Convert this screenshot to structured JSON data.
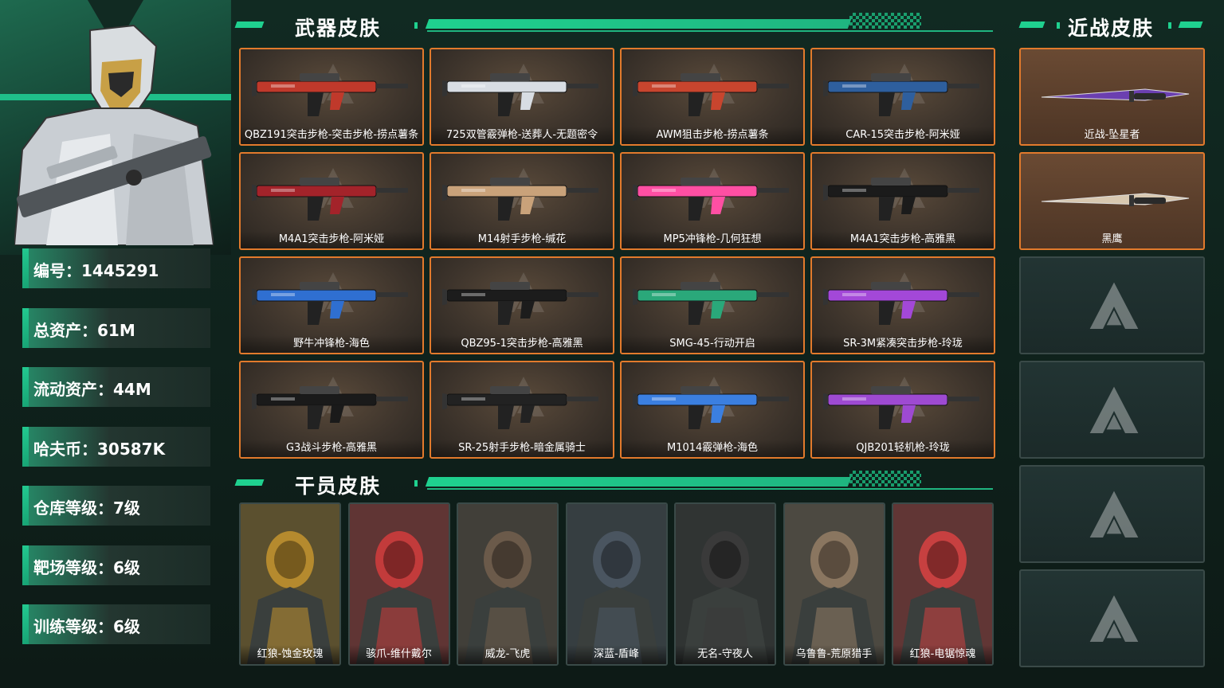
{
  "player": {
    "stats": [
      {
        "label": "编号：1445291"
      },
      {
        "label": "总资产：61M"
      },
      {
        "label": "流动资产：44M"
      },
      {
        "label": "哈夫币：30587K"
      },
      {
        "label": "仓库等级：7级"
      },
      {
        "label": "靶场等级：6级"
      },
      {
        "label": "训练等级：6级"
      }
    ]
  },
  "sections": {
    "weapon_title": "武器皮肤",
    "melee_title": "近战皮肤",
    "operator_title": "干员皮肤"
  },
  "weapons": [
    {
      "name": "QBZ191突击步枪-突击步枪-捞点薯条",
      "color": "#c0392b"
    },
    {
      "name": "725双管霰弹枪-送葬人-无题密令",
      "color": "#d8dde3"
    },
    {
      "name": "AWM狙击步枪-捞点薯条",
      "color": "#c8452e"
    },
    {
      "name": "CAR-15突击步枪-阿米娅",
      "color": "#2e5f9e"
    },
    {
      "name": "M4A1突击步枪-阿米娅",
      "color": "#a3232a"
    },
    {
      "name": "M14射手步枪-缄花",
      "color": "#c9a27a"
    },
    {
      "name": "MP5冲锋枪-几何狂想",
      "color": "#ff4fa3"
    },
    {
      "name": "M4A1突击步枪-高雅黑",
      "color": "#1b1b1b"
    },
    {
      "name": "野牛冲锋枪-海色",
      "color": "#2f6fd1"
    },
    {
      "name": "QBZ95-1突击步枪-高雅黑",
      "color": "#1c1c1c"
    },
    {
      "name": "SMG-45-行动开启",
      "color": "#2aa87a"
    },
    {
      "name": "SR-3M紧凑突击步枪-玲珑",
      "color": "#a348d8"
    },
    {
      "name": "G3战斗步枪-高雅黑",
      "color": "#1a1a1a"
    },
    {
      "name": "SR-25射手步枪-暗金属骑士",
      "color": "#222222"
    },
    {
      "name": "M1014霰弹枪-海色",
      "color": "#3b7fe0"
    },
    {
      "name": "QJB201轻机枪-玲珑",
      "color": "#9e4ad2"
    }
  ],
  "melee": [
    {
      "name": "近战-坠星者",
      "color": "#6b3fb0"
    },
    {
      "name": "黑鹰",
      "color": "#d8c8b0"
    }
  ],
  "melee_empty_slots": 4,
  "operators": [
    {
      "name": "红狼-蚀金玫瑰",
      "color": "#b58a2e"
    },
    {
      "name": "骇爪-维什戴尔",
      "color": "#c23b3b"
    },
    {
      "name": "威龙-飞虎",
      "color": "#6b5a4a"
    },
    {
      "name": "深蓝-盾峰",
      "color": "#4a5560"
    },
    {
      "name": "无名-守夜人",
      "color": "#3a3a3a"
    },
    {
      "name": "乌鲁鲁-荒原猎手",
      "color": "#8a7660"
    },
    {
      "name": "红狼-电锯惊魂",
      "color": "#c74040"
    }
  ]
}
